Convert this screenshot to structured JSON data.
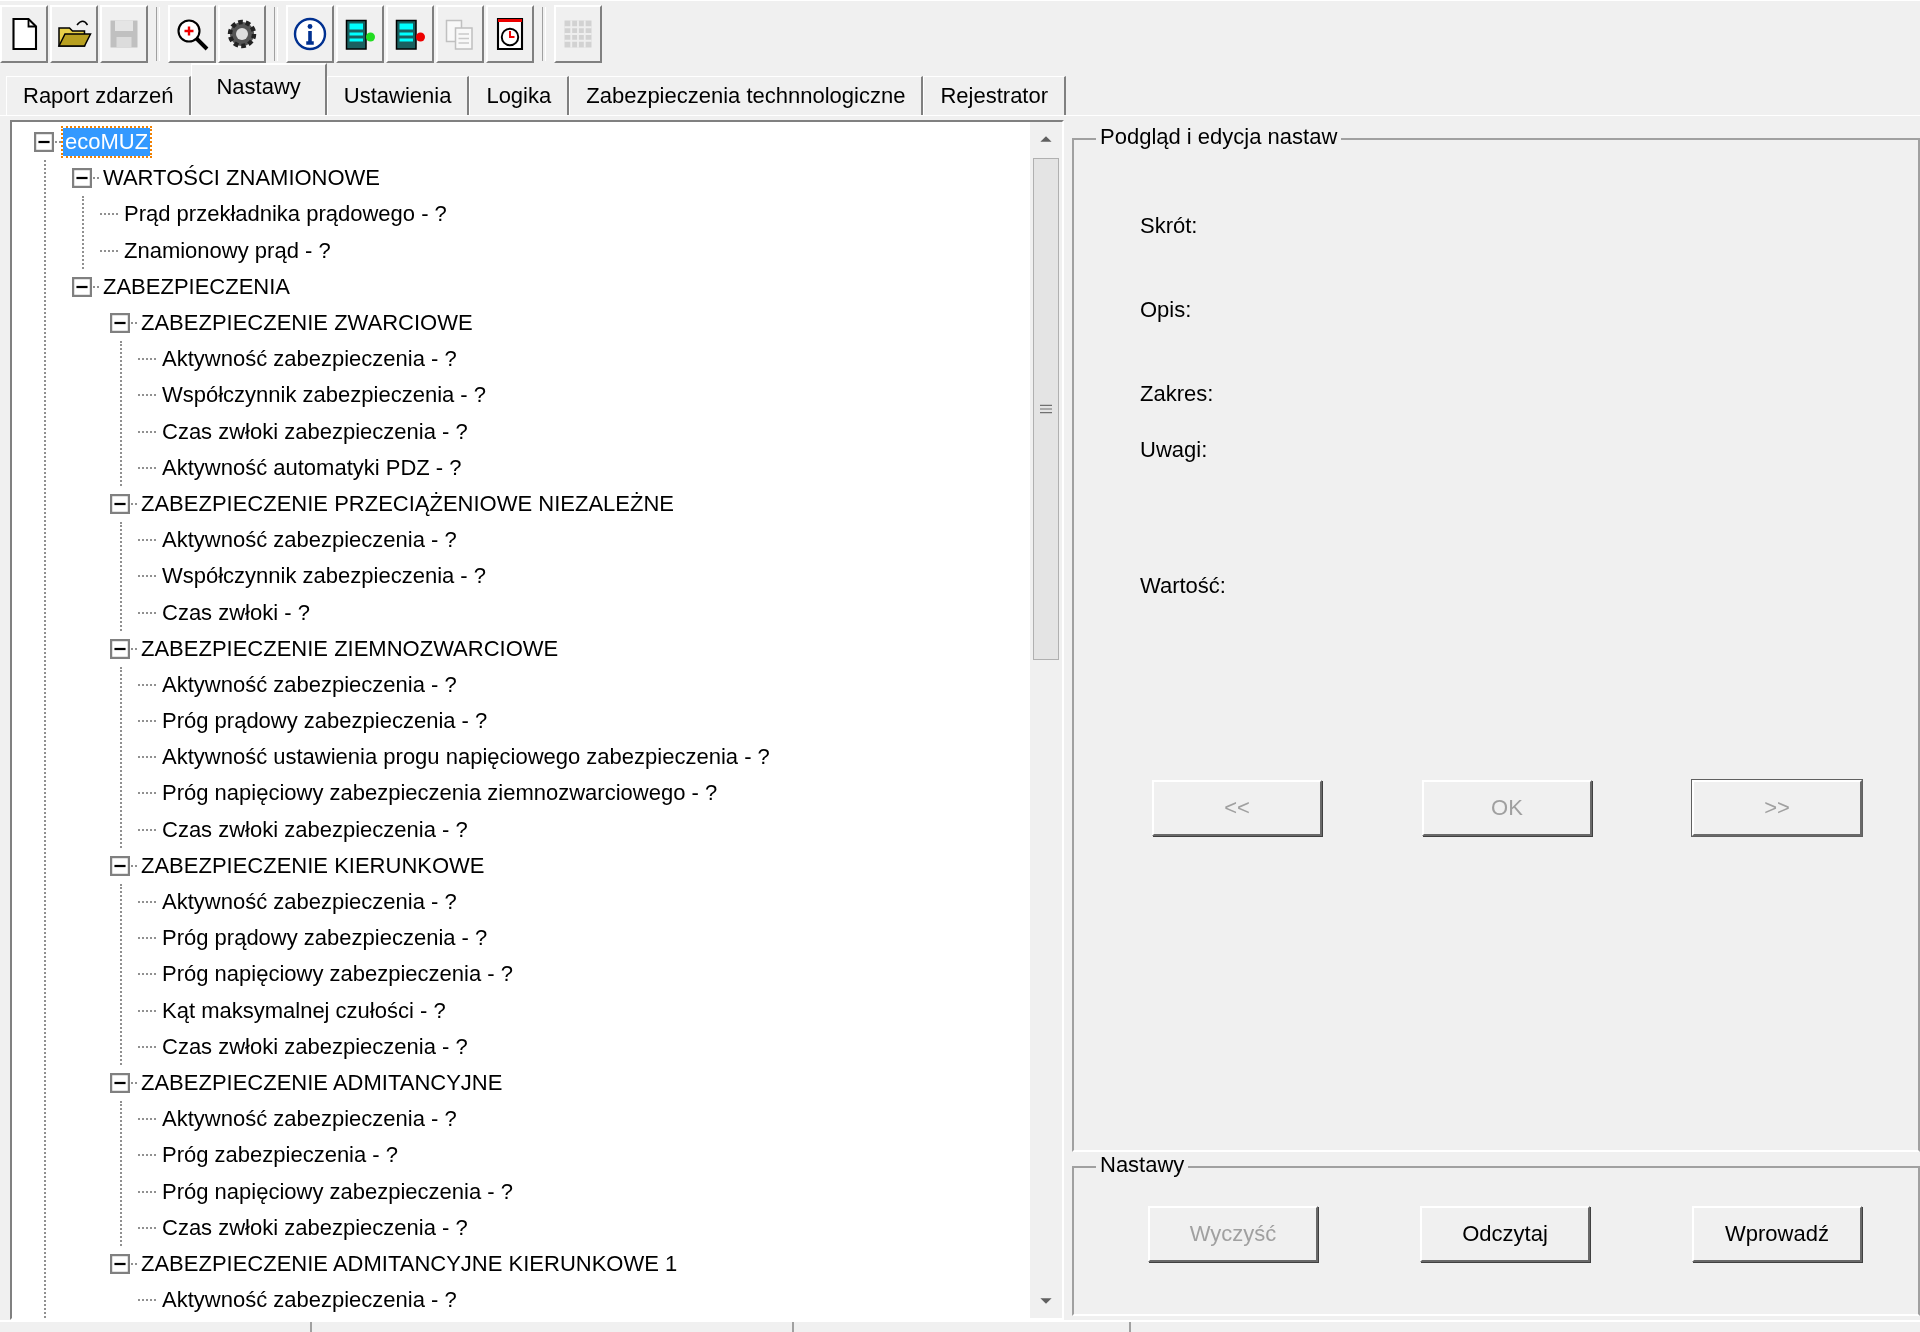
{
  "toolbar": [
    {
      "kind": "new-file",
      "disabled": false
    },
    {
      "kind": "open-folder",
      "disabled": false
    },
    {
      "kind": "save",
      "disabled": true
    },
    {
      "kind": "separator"
    },
    {
      "kind": "zoom",
      "disabled": false
    },
    {
      "kind": "gear",
      "disabled": false
    },
    {
      "kind": "separator"
    },
    {
      "kind": "info",
      "disabled": false
    },
    {
      "kind": "device-green",
      "disabled": false
    },
    {
      "kind": "device-red",
      "disabled": false
    },
    {
      "kind": "copy",
      "disabled": true
    },
    {
      "kind": "clock-document",
      "disabled": false
    },
    {
      "kind": "separator"
    },
    {
      "kind": "grid",
      "disabled": true
    }
  ],
  "tabs": [
    {
      "label": "Raport zdarzeń",
      "selected": false
    },
    {
      "label": "Nastawy",
      "selected": true
    },
    {
      "label": "Ustawienia",
      "selected": false
    },
    {
      "label": "Logika",
      "selected": false
    },
    {
      "label": "Zabezpieczenia technnologiczne",
      "selected": false
    },
    {
      "label": "Rejestrator",
      "selected": false
    }
  ],
  "tree": {
    "items": [
      {
        "label": "ecoMUZ",
        "selected": true,
        "expanded": true,
        "children": [
          {
            "label": "WARTOŚCI ZNAMIONOWE",
            "selected": false,
            "expanded": true,
            "children": [
              {
                "label": "Prąd przekładnika prądowego - ?",
                "selected": false
              },
              {
                "label": "Znamionowy prąd - ?",
                "selected": false
              }
            ]
          },
          {
            "label": "ZABEZPIECZENIA",
            "selected": false,
            "expanded": true,
            "children": [
              {
                "label": "ZABEZPIECZENIE ZWARCIOWE",
                "selected": false,
                "expanded": true,
                "children": [
                  {
                    "label": "Aktywność zabezpieczenia - ?",
                    "selected": false
                  },
                  {
                    "label": "Współczynnik zabezpieczenia - ?",
                    "selected": false
                  },
                  {
                    "label": "Czas zwłoki zabezpieczenia - ?",
                    "selected": false
                  },
                  {
                    "label": "Aktywność automatyki PDZ - ?",
                    "selected": false
                  }
                ]
              },
              {
                "label": "ZABEZPIECZENIE PRZECIĄŻENIOWE NIEZALEŻNE",
                "selected": false,
                "expanded": true,
                "children": [
                  {
                    "label": "Aktywność zabezpieczenia - ?",
                    "selected": false
                  },
                  {
                    "label": "Współczynnik zabezpieczenia - ?",
                    "selected": false
                  },
                  {
                    "label": "Czas zwłoki - ?",
                    "selected": false
                  }
                ]
              },
              {
                "label": "ZABEZPIECZENIE ZIEMNOZWARCIOWE",
                "selected": false,
                "expanded": true,
                "children": [
                  {
                    "label": "Aktywność zabezpieczenia - ?",
                    "selected": false
                  },
                  {
                    "label": "Próg prądowy zabezpieczenia - ?",
                    "selected": false
                  },
                  {
                    "label": "Aktywność ustawienia progu napięciowego zabezpieczenia - ?",
                    "selected": false
                  },
                  {
                    "label": "Próg napięciowy zabezpieczenia ziemnozwarciowego - ?",
                    "selected": false
                  },
                  {
                    "label": "Czas zwłoki zabezpieczenia - ?",
                    "selected": false
                  }
                ]
              },
              {
                "label": "ZABEZPIECZENIE KIERUNKOWE",
                "selected": false,
                "expanded": true,
                "children": [
                  {
                    "label": "Aktywność zabezpieczenia - ?",
                    "selected": false
                  },
                  {
                    "label": "Próg prądowy zabezpieczenia - ?",
                    "selected": false
                  },
                  {
                    "label": "Próg napięciowy zabezpieczenia - ?",
                    "selected": false
                  },
                  {
                    "label": "Kąt maksymalnej czułości - ?",
                    "selected": false
                  },
                  {
                    "label": "Czas zwłoki zabezpieczenia - ?",
                    "selected": false
                  }
                ]
              },
              {
                "label": "ZABEZPIECZENIE ADMITANCYJNE",
                "selected": false,
                "expanded": true,
                "children": [
                  {
                    "label": "Aktywność zabezpieczenia - ?",
                    "selected": false
                  },
                  {
                    "label": "Próg zabezpieczenia - ?",
                    "selected": false
                  },
                  {
                    "label": "Próg napięciowy zabezpieczenia - ?",
                    "selected": false
                  },
                  {
                    "label": "Czas zwłoki zabezpieczenia - ?",
                    "selected": false
                  }
                ]
              },
              {
                "label": "ZABEZPIECZENIE ADMITANCYJNE KIERUNKOWE 1",
                "selected": false,
                "expanded": true,
                "children": [
                  {
                    "label": "Aktywność zabezpieczenia - ?",
                    "selected": false
                  }
                ]
              }
            ]
          }
        ]
      }
    ]
  },
  "preview": {
    "title": "Podgląd i edycja nastaw",
    "fields": [
      {
        "label": "Skrót:"
      },
      {
        "label": "Opis:"
      },
      {
        "label": "Zakres:"
      },
      {
        "label": "Uwagi:"
      },
      {
        "label": "Wartość:"
      }
    ],
    "buttons": [
      {
        "label": "<<",
        "disabled": true,
        "default": false
      },
      {
        "label": "OK",
        "disabled": true,
        "default": false
      },
      {
        "label": ">>",
        "disabled": true,
        "default": true
      }
    ]
  },
  "settings": {
    "title": "Nastawy",
    "buttons": [
      {
        "label": "Wyczyść",
        "disabled": true
      },
      {
        "label": "Odczytaj",
        "disabled": false
      },
      {
        "label": "Wprowadź",
        "disabled": false
      }
    ]
  }
}
